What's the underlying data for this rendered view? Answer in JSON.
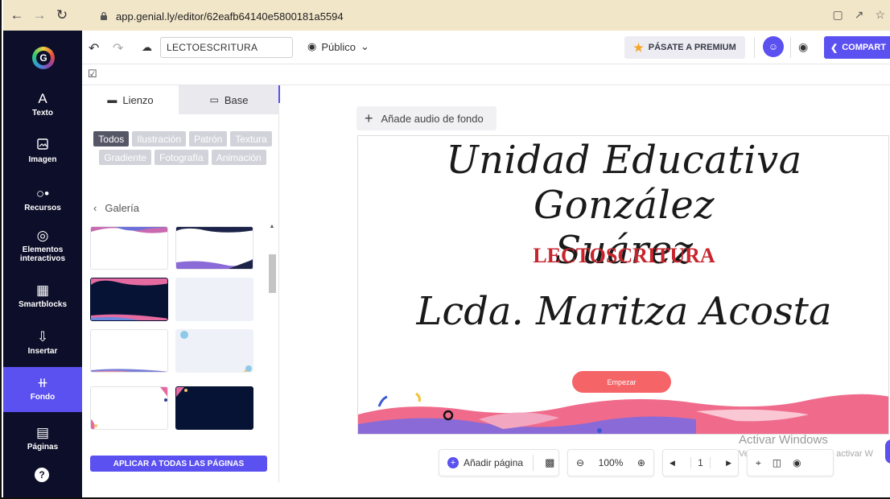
{
  "browser": {
    "url": "app.genial.ly/editor/62eafb64140e5800181a5594"
  },
  "sidebar": {
    "items": [
      {
        "label": "Texto",
        "icon": "text-icon"
      },
      {
        "label": "Imagen",
        "icon": "image-icon"
      },
      {
        "label": "Recursos",
        "icon": "resources-icon"
      },
      {
        "label": "Elementos interactivos",
        "icon": "interactive-icon"
      },
      {
        "label": "Smartblocks",
        "icon": "smartblocks-icon"
      },
      {
        "label": "Insertar",
        "icon": "insert-icon"
      },
      {
        "label": "Fondo",
        "icon": "background-icon"
      },
      {
        "label": "Páginas",
        "icon": "pages-icon"
      }
    ],
    "active": "Fondo"
  },
  "toolbar": {
    "title_value": "LECTOESCRITURA",
    "visibility": "Público",
    "premium_label": "PÁSATE A PREMIUM",
    "share_label": "COMPART"
  },
  "panel": {
    "tabs": [
      "Lienzo",
      "Base"
    ],
    "active_tab": "Lienzo",
    "filters": [
      "Todos",
      "Ilustración",
      "Patrón",
      "Textura",
      "Gradiente",
      "Fotografía",
      "Animación"
    ],
    "active_filter": "Todos",
    "gallery_label": "Galería",
    "apply_label": "APLICAR A TODAS LAS PÁGINAS"
  },
  "canvas": {
    "audio_label": "Añade audio de fondo",
    "title_line1": "Unidad Educativa González",
    "title_line2": "Suárez",
    "subtitle": "LECTOSCRITURA",
    "name": "Lcda. Maritza Acosta",
    "start_label": "Empezar"
  },
  "bottom": {
    "add_page_label": "Añadir página",
    "zoom": "100%",
    "page": "1"
  },
  "watermark": {
    "title": "Activar Windows",
    "text": "Ve a Configuración para activar W"
  },
  "colors": {
    "accent": "#5b50f0",
    "sidebar": "#0d0f2a",
    "browser_bar": "#f2e6c9",
    "subtitle": "#c8242d",
    "start_button": "#f56568"
  }
}
